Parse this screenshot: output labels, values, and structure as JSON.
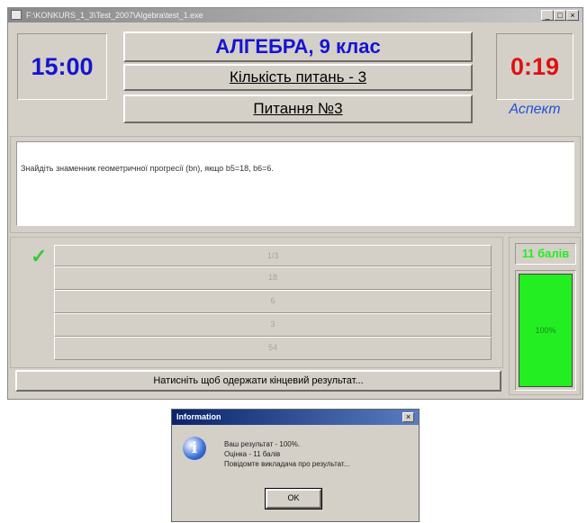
{
  "window": {
    "title": "F:\\KONKURS_1_3\\Test_2007\\Algebra\\test_1.exe",
    "min_glyph": "_",
    "max_glyph": "□",
    "close_glyph": "×"
  },
  "timers": {
    "left": "15:00",
    "right": "0:19"
  },
  "header": {
    "title": "АЛГЕБРА, 9 клас",
    "question_count": "Кількість питань - 3",
    "question_number": "Питання №3",
    "brand": "Аспект"
  },
  "question": {
    "text": "Знайдіть знаменник геометричної прогресії (bn), якщо b5=18, b6=6."
  },
  "answers": {
    "check": "✓",
    "options": [
      "1/3",
      "18",
      "6",
      "3",
      "54"
    ]
  },
  "score": {
    "label": "11 балів",
    "percent": "100%",
    "fill_fraction": 1.0
  },
  "result_button": "Натисніть щоб одержати кінцевий результат...",
  "dialog": {
    "title": "Information",
    "close_glyph": "×",
    "icon_glyph": "i",
    "lines": [
      "Ваш результат - 100%.",
      "Оцінка - 11 балів",
      "Повідомте викладача про результат..."
    ],
    "ok": "OK"
  },
  "colors": {
    "accent_blue": "#1414d2",
    "timer_red": "#e01010",
    "score_green": "#22ee22",
    "check_green": "#33cc33"
  }
}
